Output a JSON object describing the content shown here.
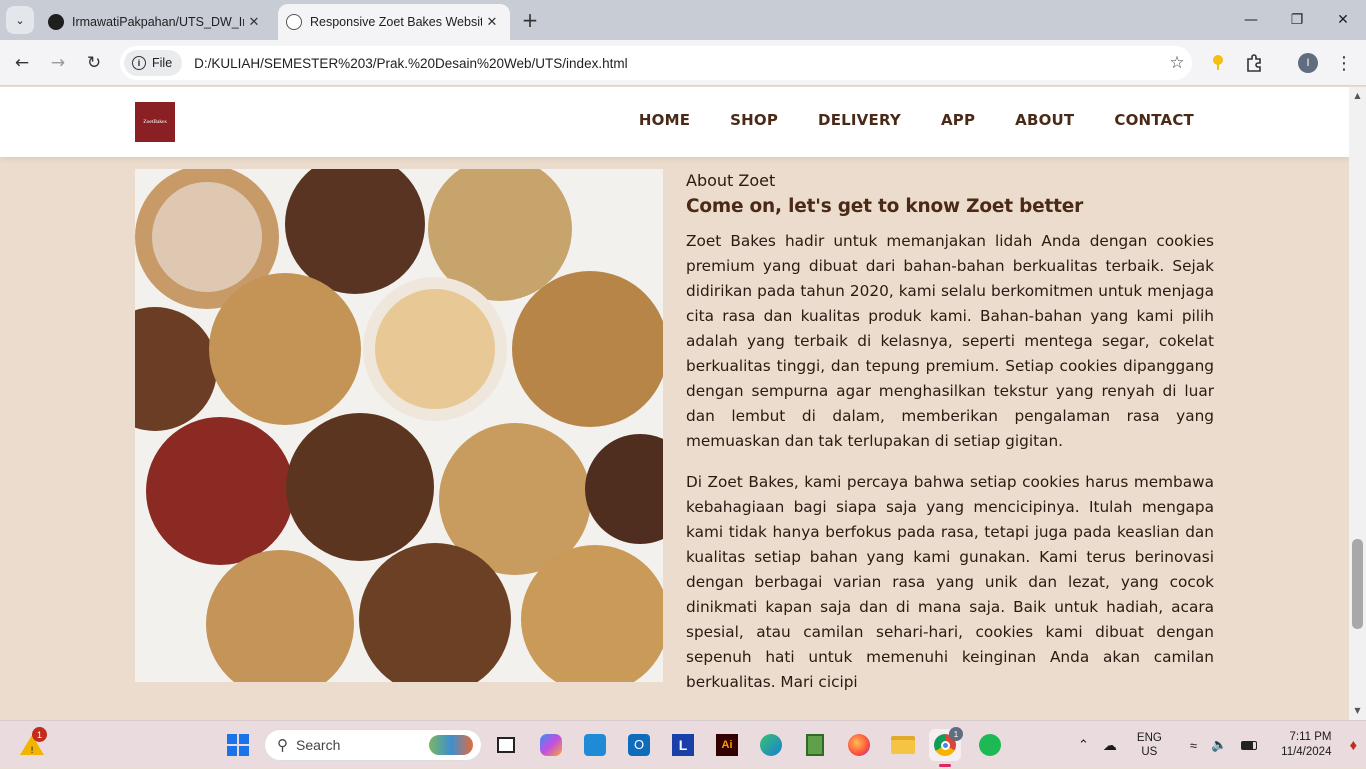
{
  "browser": {
    "tabs": [
      {
        "title": "IrmawatiPakpahan/UTS_DW_Irm",
        "active": false
      },
      {
        "title": "Responsive Zoet Bakes Website",
        "active": true
      }
    ],
    "address": {
      "chip": "File",
      "url": "D:/KULIAH/SEMESTER%203/Prak.%20Desain%20Web/UTS/index.html"
    },
    "profile_initial": "I"
  },
  "site": {
    "logo_text": "ZoetBakes",
    "nav": [
      "HOME",
      "SHOP",
      "DELIVERY",
      "APP",
      "ABOUT",
      "CONTACT"
    ],
    "about": {
      "eyebrow": "About Zoet",
      "heading": "Come on, let's get to know Zoet better",
      "p1": "Zoet Bakes hadir untuk memanjakan lidah Anda dengan cookies premium yang dibuat dari bahan-bahan berkualitas terbaik. Sejak didirikan pada tahun 2020, kami selalu berkomitmen untuk menjaga cita rasa dan kualitas produk kami. Bahan-bahan yang kami pilih adalah yang terbaik di kelasnya, seperti mentega segar, cokelat berkualitas tinggi, dan tepung premium. Setiap cookies dipanggang dengan sempurna agar menghasilkan tekstur yang renyah di luar dan lembut di dalam, memberikan pengalaman rasa yang memuaskan dan tak terlupakan di setiap gigitan.",
      "p2": "Di Zoet Bakes, kami percaya bahwa setiap cookies harus membawa kebahagiaan bagi siapa saja yang mencicipinya. Itulah mengapa kami tidak hanya berfokus pada rasa, tetapi juga pada keaslian dan kualitas setiap bahan yang kami gunakan. Kami terus berinovasi dengan berbagai varian rasa yang unik dan lezat, yang cocok dinikmati kapan saja dan di mana saja. Baik untuk hadiah, acara spesial, atau camilan sehari-hari, cookies kami dibuat dengan sepenuh hati untuk memenuhi keinginan Anda akan camilan berkualitas. Mari cicipi"
    }
  },
  "taskbar": {
    "search_placeholder": "Search",
    "weather_badge": "1",
    "chrome_badge": "1",
    "language": "ENG",
    "region": "US",
    "time": "7:11 PM",
    "date": "11/4/2024"
  },
  "colors": {
    "brand_brown": "#4a2a17",
    "page_bg": "#ecdccd",
    "logo_bg": "#8a1f24"
  }
}
